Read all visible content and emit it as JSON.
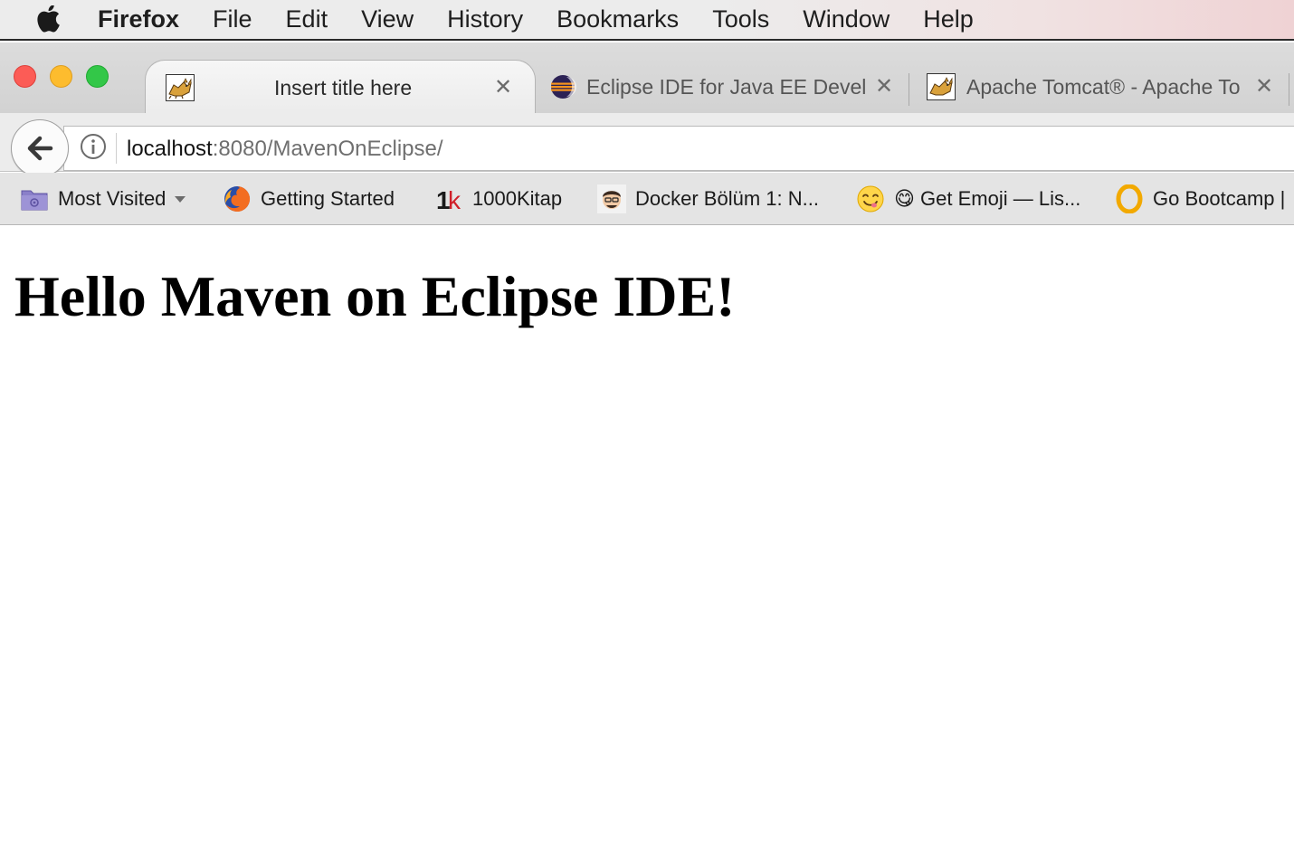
{
  "menubar": {
    "app_name": "Firefox",
    "items": [
      "File",
      "Edit",
      "View",
      "History",
      "Bookmarks",
      "Tools",
      "Window",
      "Help"
    ]
  },
  "tabs": [
    {
      "title": "Insert title here",
      "favicon": "tomcat-icon",
      "active": true
    },
    {
      "title": "Eclipse IDE for Java EE Devel",
      "favicon": "eclipse-icon",
      "active": false
    },
    {
      "title": "Apache Tomcat® - Apache To",
      "favicon": "tomcat-icon",
      "active": false
    }
  ],
  "urlbar": {
    "host": "localhost",
    "rest": ":8080/MavenOnEclipse/"
  },
  "bookmarks": [
    {
      "label": "Most Visited",
      "icon": "folder-icon"
    },
    {
      "label": "Getting Started",
      "icon": "firefox-icon"
    },
    {
      "label": "1000Kitap",
      "icon": "1k-icon"
    },
    {
      "label": "Docker Bölüm 1: N...",
      "icon": "avatar-icon"
    },
    {
      "label": "😋 Get Emoji — Lis...",
      "icon": "emoji-icon"
    },
    {
      "label": "Go Bootcamp |",
      "icon": "opera-icon"
    }
  ],
  "page": {
    "heading": "Hello Maven on Eclipse IDE!"
  },
  "colors": {
    "close": "#fc5c56",
    "minimize": "#fdbc2e",
    "maximize": "#33c748"
  }
}
